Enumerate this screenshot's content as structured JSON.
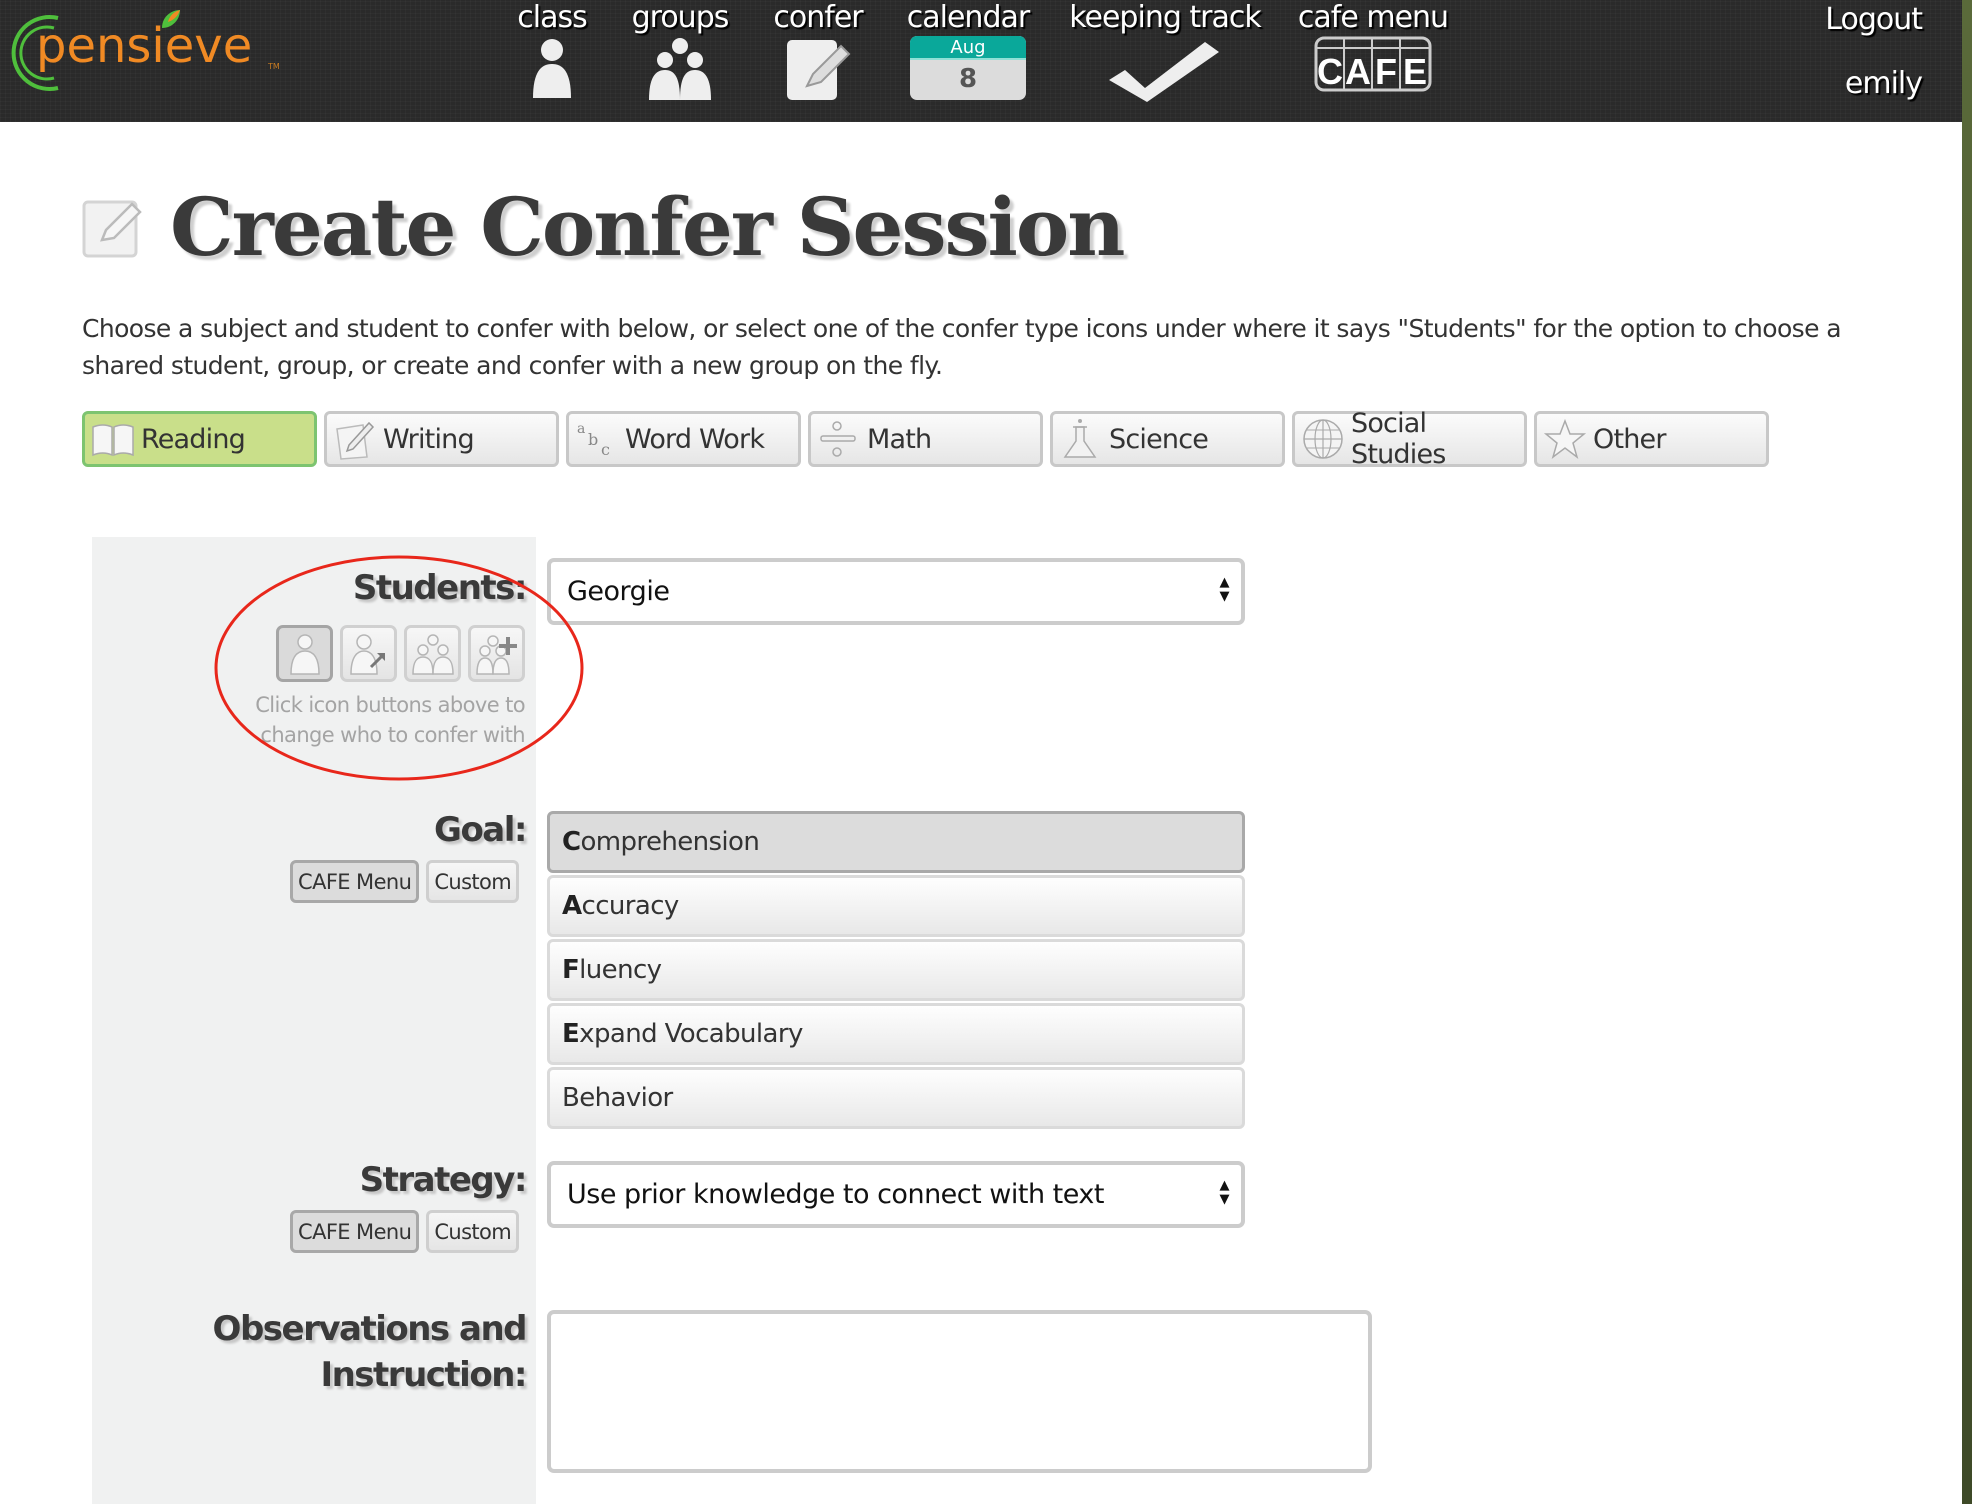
{
  "header": {
    "logo_text": "pensieve",
    "logo_tm": "TM",
    "nav": [
      {
        "label": "class",
        "icon": "person-icon"
      },
      {
        "label": "groups",
        "icon": "group-icon"
      },
      {
        "label": "confer",
        "icon": "notepad-pencil-icon"
      },
      {
        "label": "calendar",
        "icon": "calendar-icon",
        "month": "Aug",
        "day": "8"
      },
      {
        "label": "keeping track",
        "icon": "checkmark-icon"
      },
      {
        "label": "cafe menu",
        "icon": "cafe-icon",
        "badge_letters": [
          "C",
          "A",
          "F",
          "E"
        ]
      }
    ],
    "logout_label": "Logout",
    "username": "emily"
  },
  "page": {
    "title": "Create Confer Session",
    "description": "Choose a subject and student to confer with below, or select one of the confer type icons under where it says \"Students\" for the option to choose a shared student, group, or create and confer with a new group on the fly."
  },
  "subjects": {
    "active": "Reading",
    "tabs": [
      {
        "label": "Reading",
        "icon": "book-icon"
      },
      {
        "label": "Writing",
        "icon": "paper-pencil-icon"
      },
      {
        "label": "Word Work",
        "icon": "abc-icon"
      },
      {
        "label": "Math",
        "icon": "division-icon"
      },
      {
        "label": "Science",
        "icon": "flask-icon"
      },
      {
        "label": "Social Studies",
        "icon": "globe-icon"
      },
      {
        "label": "Other",
        "icon": "star-icon"
      }
    ]
  },
  "form": {
    "students": {
      "label": "Students:",
      "selected": "Georgie",
      "who_buttons": [
        {
          "name": "single-student",
          "icon": "person-icon",
          "active": true
        },
        {
          "name": "shared-student",
          "icon": "person-share-icon",
          "active": false
        },
        {
          "name": "group",
          "icon": "group-icon",
          "active": false
        },
        {
          "name": "new-group",
          "icon": "group-add-icon",
          "active": false
        }
      ],
      "hint": "Click icon buttons above to change who to confer with"
    },
    "goal": {
      "label": "Goal:",
      "source_buttons": [
        "CAFE Menu",
        "Custom"
      ],
      "active_source": "CAFE Menu",
      "selected": "Comprehension",
      "options": [
        {
          "initial": "C",
          "rest": "omprehension"
        },
        {
          "initial": "A",
          "rest": "ccuracy"
        },
        {
          "initial": "F",
          "rest": "luency"
        },
        {
          "initial": "E",
          "rest": "xpand Vocabulary"
        },
        {
          "initial": "",
          "rest": "Behavior"
        }
      ]
    },
    "strategy": {
      "label": "Strategy:",
      "source_buttons": [
        "CAFE Menu",
        "Custom"
      ],
      "active_source": "CAFE Menu",
      "selected": "Use prior knowledge to connect with text"
    },
    "observations": {
      "label_line1": "Observations and",
      "label_line2": "Instruction:",
      "value": ""
    }
  },
  "annotation": {
    "ellipse_color": "#e8271b"
  },
  "colors": {
    "header_bg": "#2a2a2a",
    "logo_orange": "#f08a24",
    "logo_green": "#4fbf3c",
    "calendar_teal": "#0aa89a",
    "active_tab_bg": "#c9df8a",
    "active_tab_border": "#7dc470"
  }
}
